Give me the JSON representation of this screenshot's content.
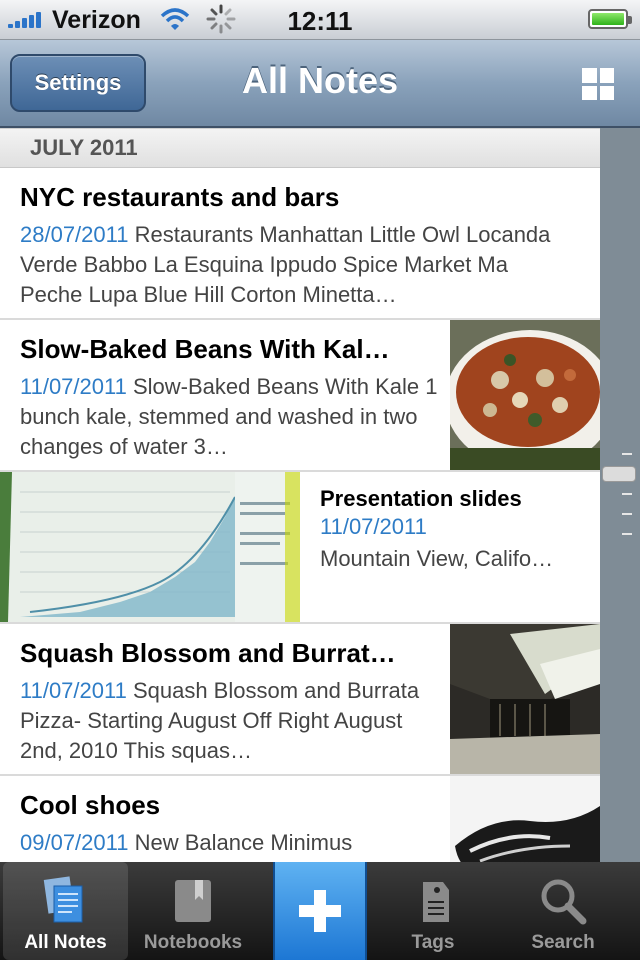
{
  "status_bar": {
    "carrier": "Verizon",
    "time": "12:11",
    "battery_level": 1.0
  },
  "nav": {
    "left_button": "Settings",
    "title": "All Notes",
    "right_icon": "grid-view-icon"
  },
  "section": {
    "header": "JULY 2011"
  },
  "notes": [
    {
      "title": "NYC restaurants and bars",
      "date": "28/07/2011",
      "snippet": " Restaurants Manhattan Little Owl Locanda Verde Babbo La Esquina Ippudo Spice Market Ma Peche Lupa Blue Hill Corton Minetta…",
      "thumbnail": "none"
    },
    {
      "title": "Slow-Baked Beans With Kal…",
      "date": "11/07/2011",
      "snippet": " Slow-Baked Beans With Kale 1 bunch kale, stemmed and washed in two changes of water 3…",
      "thumbnail": "baked-beans-photo"
    },
    {
      "title": "Presentation slides",
      "date": "11/07/2011",
      "snippet": "Mountain View, Califo…",
      "thumbnail": "slide-chart-photo"
    },
    {
      "title": "Squash Blossom and Burrat…",
      "date": "11/07/2011",
      "snippet": " Squash Blossom and Burrata Pizza- Starting August Off Right August 2nd, 2010 This squas…",
      "thumbnail": "attic-room-photo"
    },
    {
      "title": "Cool shoes",
      "date": "09/07/2011",
      "snippet": " New Balance Minimus",
      "thumbnail": "shoe-photo"
    }
  ],
  "tab_bar": {
    "tabs": [
      {
        "label": "All Notes",
        "icon": "notes-stack-icon",
        "active": true
      },
      {
        "label": "Notebooks",
        "icon": "notebook-icon",
        "active": false
      },
      {
        "label": "",
        "icon": "plus-icon",
        "active": false
      },
      {
        "label": "Tags",
        "icon": "tag-icon",
        "active": false
      },
      {
        "label": "Search",
        "icon": "magnifier-icon",
        "active": false
      }
    ]
  },
  "colors": {
    "accent_date": "#2e7cc6",
    "nav_bar": "#8aa2bb",
    "add_button": "#1d77d4"
  }
}
